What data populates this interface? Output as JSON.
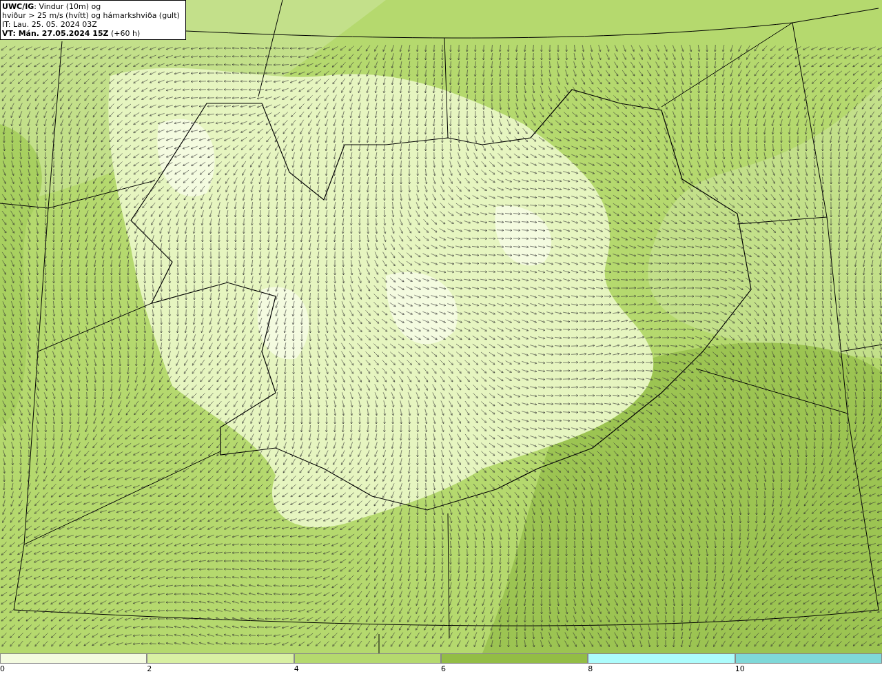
{
  "title_box": {
    "lines": [
      "**UWC/IG**: Vindur (10m) og",
      "hviður > 25 m/s (hvítt) og hámarkshviða (gult)",
      "IT: Lau. 25. 05. 2024 03Z",
      "**VT: Mán. 27.05.2024 15Z** (+60 h)"
    ]
  },
  "legend": {
    "bins": [
      {
        "color": "#f4fbe0",
        "label": "0"
      },
      {
        "color": "#d9f0a3",
        "label": "2"
      },
      {
        "color": "#b5d96e",
        "label": "4"
      },
      {
        "color": "#93bd45",
        "label": "6"
      },
      {
        "color": "#adfcfc",
        "label": "8"
      },
      {
        "color": "#7fd8d8",
        "label": "10"
      }
    ]
  }
}
